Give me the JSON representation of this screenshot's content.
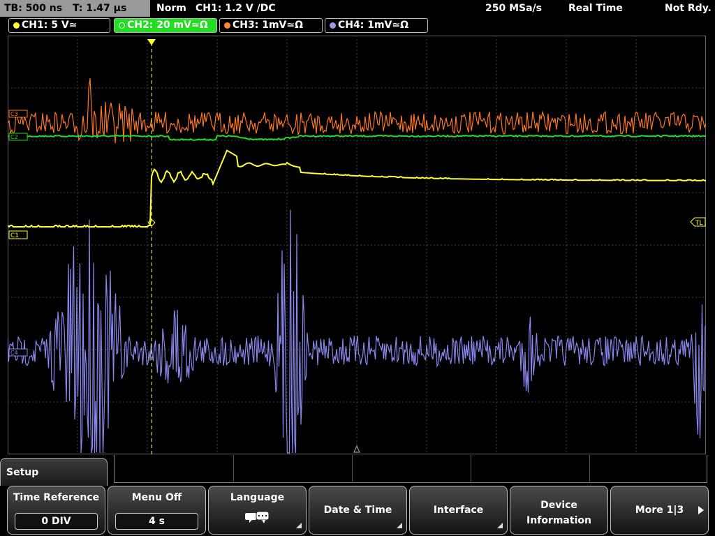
{
  "status": {
    "timebase": "TB: 500 ns",
    "trigger_time": "T: 1.47 µs",
    "mode": "Norm",
    "trigger": "CH1: 1.2 V ∕DC",
    "sample_rate": "250 MSa/s",
    "acq_mode": "Real Time",
    "state": "Not Rdy."
  },
  "channels": [
    {
      "label": "CH1: 5 V≃",
      "color": "#ffff33",
      "active": false
    },
    {
      "label": "CH2: 20 mV≃Ω",
      "color": "#22dd22",
      "active": true
    },
    {
      "label": "CH3: 1mV≃Ω",
      "color": "#ff8833",
      "active": false
    },
    {
      "label": "CH4: 1mV≃Ω",
      "color": "#9999ee",
      "active": false
    }
  ],
  "markers": {
    "ch1": "C1",
    "ch2": "C2",
    "ch3": "C3",
    "ch4": "C4",
    "trigger_level": "TL"
  },
  "colors": {
    "ch1": "#ffff33",
    "ch2": "#22dd22",
    "ch3": "#ff7722",
    "ch4": "#8888ee",
    "grid": "#555555"
  },
  "menu": {
    "title": "Setup",
    "softkeys": [
      {
        "label": "Time Reference",
        "value": "0 DIV"
      },
      {
        "label": "Menu Off",
        "value": "4 s"
      },
      {
        "label": "Language",
        "icon": "speech-bubbles-icon"
      },
      {
        "label": "Date & Time"
      },
      {
        "label": "Interface"
      },
      {
        "label_line1": "Device",
        "label_line2": "Information"
      },
      {
        "label": "More 1|3",
        "icon": "arrow-right-icon"
      }
    ]
  }
}
